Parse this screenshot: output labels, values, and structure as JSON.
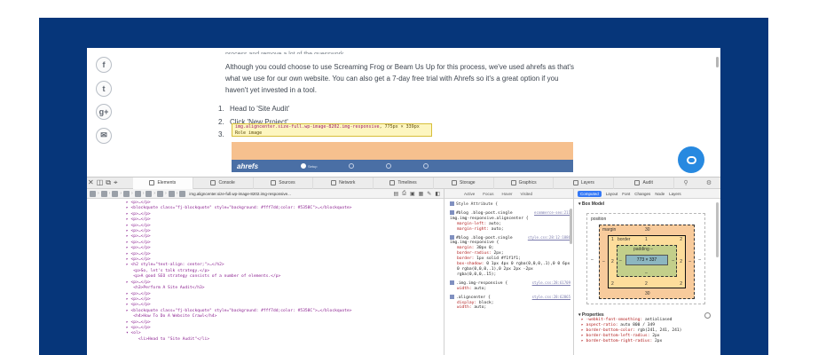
{
  "article": {
    "cut_line": "process and remove a lot of the guesswork.",
    "paragraph": "Although you could choose to use Screaming Frog or Beam Us Up for this process, we've used ahrefs as that's what we use for our own website. You can also get a 7-day free trial with Ahrefs so it's a great option if you haven't yet invested in a tool.",
    "steps": [
      {
        "num": "1.",
        "text": "Head to 'Site Audit'"
      },
      {
        "num": "2.",
        "text": "Click 'New Project'"
      },
      {
        "num": "3.",
        "text": ""
      }
    ],
    "tooltip_selector": "img.aligncenter.size-full.wp-image-8202.img-responsive",
    "tooltip_dims": ", 775px × 339px",
    "tooltip_role": "Role image",
    "ahrefs_logo": "ahrefs",
    "ahrefs_tab1": "Setup"
  },
  "social": [
    "f",
    "t",
    "g+",
    "✉"
  ],
  "devtools": {
    "tabs": [
      "Elements",
      "Console",
      "Sources",
      "Network",
      "Timelines",
      "Storage",
      "Graphics",
      "Layers",
      "Audit"
    ],
    "breadcrumb_last": "img.aligncenter.size-full.wp-image-8202.img-responsive...",
    "dom_lines": [
      {
        "t": "▸ <p>…</p>"
      },
      {
        "t": "▸ <blockquote class=\"fj-blockquote\" style=\"background: #fff7dd;color: #5358C\">…</blockquote>"
      },
      {
        "t": "▸ <p>…</p>"
      },
      {
        "t": "▸ <p>…</p>"
      },
      {
        "t": "▸ <p>…</p>"
      },
      {
        "t": "▸ <p>…</p>"
      },
      {
        "t": "▸ <p>…</p>"
      },
      {
        "t": "▸ <p>…</p>"
      },
      {
        "t": "▸ <p>…</p>"
      },
      {
        "t": "▸ <p>…</p>"
      },
      {
        "t": "▸ <p>…</p>"
      },
      {
        "t": "▸ <h2 style=\"text-align: center;\">…</h2>"
      },
      {
        "t": "   <p>So, let's talk strategy.</p>"
      },
      {
        "t": "   <p>A good SEO strategy consists of a number of elements.</p>"
      },
      {
        "t": "▸ <p>…</p>"
      },
      {
        "t": "   <h3>Perform A Site Audit</h3>"
      },
      {
        "t": "▸ <p>…</p>"
      },
      {
        "t": "▸ <p>…</p>"
      },
      {
        "t": "▸ <p>…</p>"
      },
      {
        "t": "▸ <blockquote class=\"fj-blockquote\" style=\"background: #fff7dd;color: #5358C\">…</blockquote>"
      },
      {
        "t": "   <h4>How To Do A Website Crawl</h4>"
      },
      {
        "t": "▸ <p>…</p>"
      },
      {
        "t": "▸ <p>…</p>"
      },
      {
        "t": "▾ <ol>"
      },
      {
        "t": "     <li>Head to \"Site Audit\"</li>"
      }
    ],
    "styles": {
      "tabs": [
        "Active",
        "Focus",
        "Hover",
        "Visited"
      ],
      "style_attribute": "Style Attribute  {",
      "rules": [
        {
          "selector": "#blog .blog-post.single img.img-responsive.aligncenter {",
          "source": "ecommerce-seo:211",
          "props": [
            [
              "margin-left",
              "auto;"
            ],
            [
              "margin-right",
              "auto;"
            ]
          ]
        },
        {
          "selector": "#blog .blog-post.single img.img-responsive {",
          "source": "style.css:28:12:1886",
          "props": [
            [
              "margin",
              "30px 0;"
            ],
            [
              "border-radius",
              "2px;"
            ],
            [
              "border",
              "1px solid #f1f1f1;"
            ],
            [
              "box-shadow",
              "0 1px 4px 0 rgba(0,0,0,.1),0 0 6px 0 rgba(0,0,0,.1),0 2px 2px -2px rgba(0,0,0,.15);"
            ]
          ]
        },
        {
          "selector": ".img.img-responsive {",
          "source": "style.css:28:61709",
          "props": [
            [
              "width",
              "auto;"
            ]
          ]
        },
        {
          "selector": ".aligncenter {",
          "source": "style.css:28:62865",
          "props": [
            [
              "display",
              "block;"
            ],
            [
              "width",
              "auto;"
            ]
          ]
        }
      ]
    },
    "computed": {
      "tabs": [
        "Computed",
        "Layout",
        "Font",
        "Changes",
        "Node",
        "Layers"
      ],
      "box_model_title": "Box Model",
      "position_label": "position",
      "position_dash": "–",
      "margin_label": "margin",
      "margin_top": "30",
      "margin_bottom": "30",
      "margin_left": "–",
      "margin_right": "–",
      "border_label": "border",
      "border_val": "1",
      "border_left": "2",
      "border_right": "2",
      "border_bottom": "2",
      "padding_label": "padding –",
      "padding_bottom": "–",
      "padding_left": "–",
      "padding_right": "–",
      "content": "773 × 337",
      "outer_left": "1",
      "outer_right": "1",
      "properties_title": "Properties",
      "properties": [
        [
          "-webkit-font-smoothing",
          "antialiased"
        ],
        [
          "aspect-ratio",
          "auto 800 / 349"
        ],
        [
          "border-bottom-color",
          "rgb(241, 241, 241)"
        ],
        [
          "border-bottom-left-radius",
          "2px"
        ],
        [
          "border-bottom-right-radius",
          "2px"
        ]
      ]
    }
  }
}
